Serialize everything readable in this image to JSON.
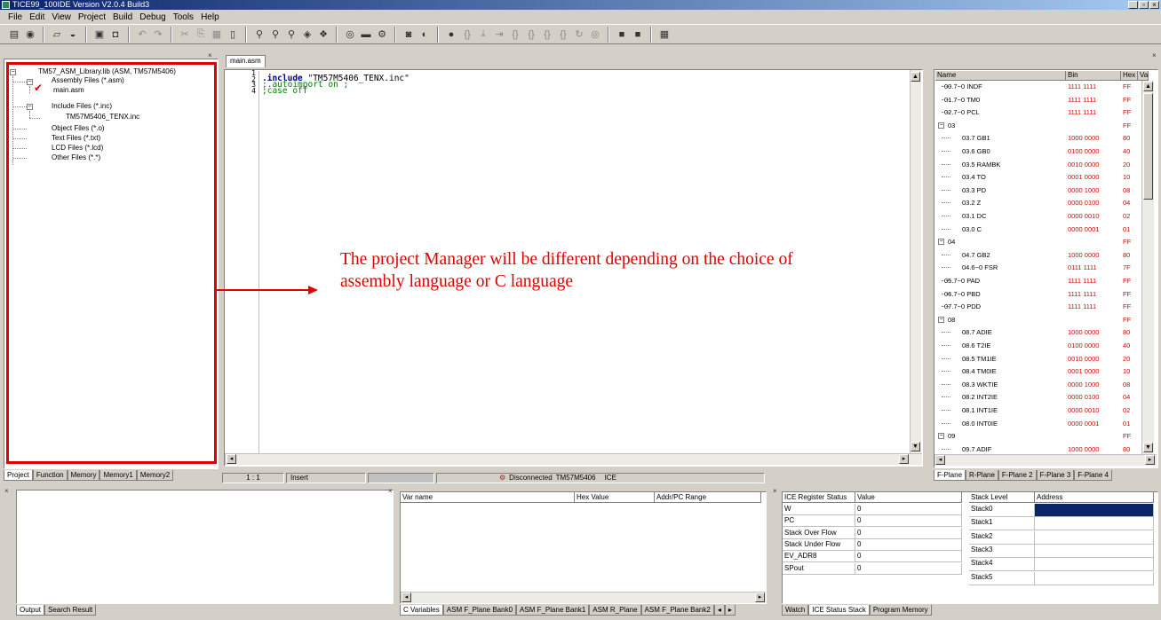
{
  "window": {
    "title": "TICE99_100IDE Version V2.0.4 Build3",
    "min": "_",
    "max": "▫",
    "close": "×"
  },
  "menu": [
    "File",
    "Edit",
    "View",
    "Project",
    "Build",
    "Debug",
    "Tools",
    "Help"
  ],
  "project": {
    "root": "TM57_ASM_Library.lib (ASM, TM57M5406)",
    "assembly_group": "Assembly Files (*.asm)",
    "main_file": "main.asm",
    "include_group": "Include Files (*.inc)",
    "include_file": "TM57M5406_TENX.inc",
    "object_group": "Object Files (*.o)",
    "text_group": "Text Files (*.txt)",
    "lcd_group": "LCD Files (*.lcd)",
    "other_group": "Other Files (*.*)",
    "tabs": [
      "Project",
      "Function",
      "Memory",
      "Memory1",
      "Memory2"
    ]
  },
  "editor": {
    "tab": "main.asm",
    "line_numbers": [
      "1",
      "2",
      "3",
      "4"
    ],
    "line1_kw": ".include",
    "line1_str": " \"TM57M5406_TENX.inc\"",
    "line2": ";.autoimport on ;",
    "line3": ";case off"
  },
  "status": {
    "pos": "1 : 1",
    "mode": "Insert",
    "conn": "Disconnected",
    "chip": "TM57M5406",
    "ice": "ICE"
  },
  "annotation": {
    "line1": "The project Manager will be different depending on the choice of",
    "line2": "assembly language or C language"
  },
  "registers": {
    "headers": [
      "Name",
      "Bin",
      "Hex",
      "Va"
    ],
    "rows": [
      {
        "name": "00.7~0 INDF",
        "bin": "1111 1111",
        "hex": "FF"
      },
      {
        "name": "01.7~0 TM0",
        "bin": "1111 1111",
        "hex": "FF"
      },
      {
        "name": "02.7~0 PCL",
        "bin": "1111 1111",
        "hex": "FF"
      },
      {
        "name": "03",
        "bin": "",
        "hex": "FF"
      },
      {
        "name": "03.7 GB1",
        "bin": "1000 0000",
        "hex": "80"
      },
      {
        "name": "03.6 GB0",
        "bin": "0100 0000",
        "hex": "40"
      },
      {
        "name": "03.5 RAMBK",
        "bin": "0010 0000",
        "hex": "20"
      },
      {
        "name": "03.4 TO",
        "bin": "0001 0000",
        "hex": "10"
      },
      {
        "name": "03.3 PD",
        "bin": "0000 1000",
        "hex": "08"
      },
      {
        "name": "03.2 Z",
        "bin": "0000 0100",
        "hex": "04"
      },
      {
        "name": "03.1 DC",
        "bin": "0000 0010",
        "hex": "02"
      },
      {
        "name": "03.0 C",
        "bin": "0000 0001",
        "hex": "01"
      },
      {
        "name": "04",
        "bin": "",
        "hex": "FF"
      },
      {
        "name": "04.7 GB2",
        "bin": "1000 0000",
        "hex": "80"
      },
      {
        "name": "04.6~0 FSR",
        "bin": "0111 1111",
        "hex": "7F"
      },
      {
        "name": "05.7~0 PAD",
        "bin": "1111 1111",
        "hex": "FF"
      },
      {
        "name": "06.7~0 PBD",
        "bin": "1111 1111",
        "hex": "FF"
      },
      {
        "name": "07.7~0 PDD",
        "bin": "1111 1111",
        "hex": "FF"
      },
      {
        "name": "08",
        "bin": "",
        "hex": "FF"
      },
      {
        "name": "08.7 ADIE",
        "bin": "1000 0000",
        "hex": "80"
      },
      {
        "name": "08.6 T2IE",
        "bin": "0100 0000",
        "hex": "40"
      },
      {
        "name": "08.5 TM1IE",
        "bin": "0010 0000",
        "hex": "20"
      },
      {
        "name": "08.4 TM0IE",
        "bin": "0001 0000",
        "hex": "10"
      },
      {
        "name": "08.3 WKTIE",
        "bin": "0000 1000",
        "hex": "08"
      },
      {
        "name": "08.2 INT2IE",
        "bin": "0000 0100",
        "hex": "04"
      },
      {
        "name": "08.1 INT1IE",
        "bin": "0000 0010",
        "hex": "02"
      },
      {
        "name": "08.0 INT0IE",
        "bin": "0000 0001",
        "hex": "01"
      },
      {
        "name": "09",
        "bin": "",
        "hex": "FF"
      },
      {
        "name": "09.7 ADIF",
        "bin": "1000 0000",
        "hex": "80"
      }
    ],
    "tabs": [
      "F-Plane",
      "R-Plane",
      "F-Plane 2",
      "F-Plane 3",
      "F-Plane 4"
    ]
  },
  "output": {
    "tabs": [
      "Output",
      "Search Result"
    ]
  },
  "cvars": {
    "headers": [
      "Var name",
      "Hex Value",
      "Addr/PC Range"
    ],
    "tabs": [
      "C Variables",
      "ASM F_Plane Bank0",
      "ASM F_Plane Bank1",
      "ASM R_Plane",
      "ASM F_Plane Bank2"
    ]
  },
  "ice": {
    "headers": [
      "ICE Register Status",
      "Value"
    ],
    "rows": [
      {
        "name": "W",
        "value": "0"
      },
      {
        "name": "PC",
        "value": "0"
      },
      {
        "name": "Stack Over Flow",
        "value": "0"
      },
      {
        "name": "Stack Under Flow",
        "value": "0"
      },
      {
        "name": "EV_ADR8",
        "value": "0"
      },
      {
        "name": "SPout",
        "value": "0"
      }
    ]
  },
  "stack": {
    "headers": [
      "Stack Level",
      "Address"
    ],
    "rows": [
      "Stack0",
      "Stack1",
      "Stack2",
      "Stack3",
      "Stack4",
      "Stack5"
    ],
    "tabs": [
      "Watch",
      "ICE Status Stack",
      "Program Memory"
    ]
  },
  "colors": {
    "accent_red": "#e00000",
    "selection": "#0a246a",
    "title_start": "#0a246a"
  }
}
